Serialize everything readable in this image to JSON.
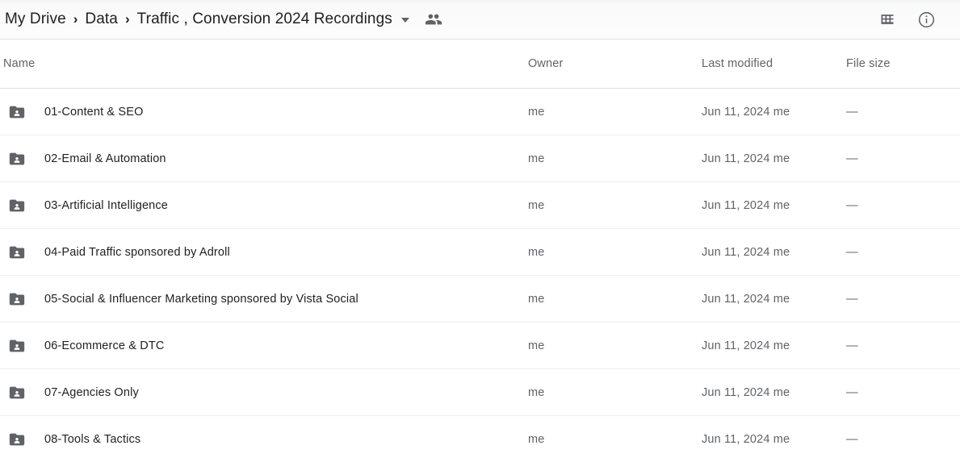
{
  "breadcrumb": {
    "items": [
      {
        "label": "My Drive",
        "name": "breadcrumb-my-drive"
      },
      {
        "label": "Data",
        "name": "breadcrumb-data"
      },
      {
        "label": "Traffic , Conversion 2024 Recordings",
        "name": "breadcrumb-current-folder"
      }
    ],
    "separator": "›",
    "caret_icon": "chevron-down-icon",
    "shared_icon": "people-shared-icon"
  },
  "toolbar": {
    "grid_view_icon": "grid-view-icon",
    "details_info_icon": "info-circle-icon"
  },
  "columns": {
    "name": "Name",
    "owner": "Owner",
    "last_modified": "Last modified",
    "file_size": "File size"
  },
  "files": [
    {
      "name": "01-Content & SEO",
      "owner": "me",
      "modified": "Jun 11, 2024 me",
      "size": "—",
      "icon": "shared-folder-icon"
    },
    {
      "name": "02-Email & Automation",
      "owner": "me",
      "modified": "Jun 11, 2024 me",
      "size": "—",
      "icon": "shared-folder-icon"
    },
    {
      "name": "03-Artificial Intelligence",
      "owner": "me",
      "modified": "Jun 11, 2024 me",
      "size": "—",
      "icon": "shared-folder-icon"
    },
    {
      "name": "04-Paid Traffic sponsored by Adroll",
      "owner": "me",
      "modified": "Jun 11, 2024 me",
      "size": "—",
      "icon": "shared-folder-icon"
    },
    {
      "name": "05-Social & Influencer Marketing sponsored by Vista Social",
      "owner": "me",
      "modified": "Jun 11, 2024 me",
      "size": "—",
      "icon": "shared-folder-icon"
    },
    {
      "name": "06-Ecommerce & DTC",
      "owner": "me",
      "modified": "Jun 11, 2024 me",
      "size": "—",
      "icon": "shared-folder-icon"
    },
    {
      "name": "07-Agencies Only",
      "owner": "me",
      "modified": "Jun 11, 2024 me",
      "size": "—",
      "icon": "shared-folder-icon"
    },
    {
      "name": "08-Tools & Tactics",
      "owner": "me",
      "modified": "Jun 11, 2024 me",
      "size": "—",
      "icon": "shared-folder-icon"
    }
  ],
  "colors": {
    "folder": "#5f6368",
    "text_primary": "#202124",
    "text_secondary": "#5f6368",
    "divider": "#eeeeee"
  }
}
